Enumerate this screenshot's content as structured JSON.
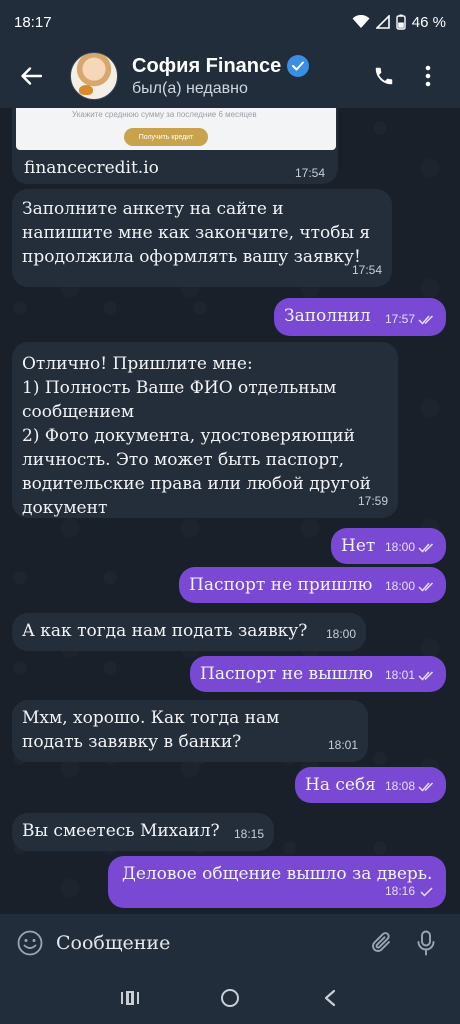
{
  "status_bar": {
    "time": "18:17",
    "battery": "46 %"
  },
  "header": {
    "name": "София Finance",
    "presence": "был(а) недавно"
  },
  "link_preview": {
    "preview_subtext": "Укажите среднюю сумму за последние 6 месяцев",
    "preview_button": "Получить кредит",
    "url": "financecredit.io",
    "time": "17:54"
  },
  "messages": [
    {
      "dir": "in",
      "text": "Заполните анкету на сайте и напишите мне как закончите, чтобы я продолжила оформлять вашу заявку!",
      "time": "17:54"
    },
    {
      "dir": "out",
      "text": "Заполнил",
      "time": "17:57"
    },
    {
      "dir": "in",
      "text": "Отлично! Пришлите мне:\n1) Полность Ваше ФИО отдельным сообщением\n2) Фото документа, удостоверяющий личность. Это может быть паспорт, водительские права или любой другой документ",
      "time": "17:59"
    },
    {
      "dir": "out",
      "text": "Нет",
      "time": "18:00"
    },
    {
      "dir": "out",
      "text": "Паспорт не пришлю",
      "time": "18:00"
    },
    {
      "dir": "in",
      "text": "А как тогда нам подать заявку?",
      "time": "18:00"
    },
    {
      "dir": "out",
      "text": "Паспорт не вышлю",
      "time": "18:01"
    },
    {
      "dir": "in",
      "text": "Мхм, хорошо. Как тогда нам подать завявку в банки?",
      "time": "18:01"
    },
    {
      "dir": "out",
      "text": "На себя",
      "time": "18:08"
    },
    {
      "dir": "in",
      "text": "Вы смеетесь Михаил?",
      "time": "18:15"
    },
    {
      "dir": "out",
      "text": "Деловое общение вышло за дверь.",
      "time": "18:16"
    }
  ],
  "composer": {
    "placeholder": "Сообщение"
  },
  "colors": {
    "incoming": "#242e3b",
    "outgoing": "#7a49d4",
    "header": "#212d3b"
  },
  "icons": [
    "back-arrow-icon",
    "verified-badge-icon",
    "phone-icon",
    "more-vert-icon",
    "emoji-icon",
    "attach-icon",
    "mic-icon",
    "recents-icon",
    "home-icon",
    "nav-back-icon"
  ]
}
